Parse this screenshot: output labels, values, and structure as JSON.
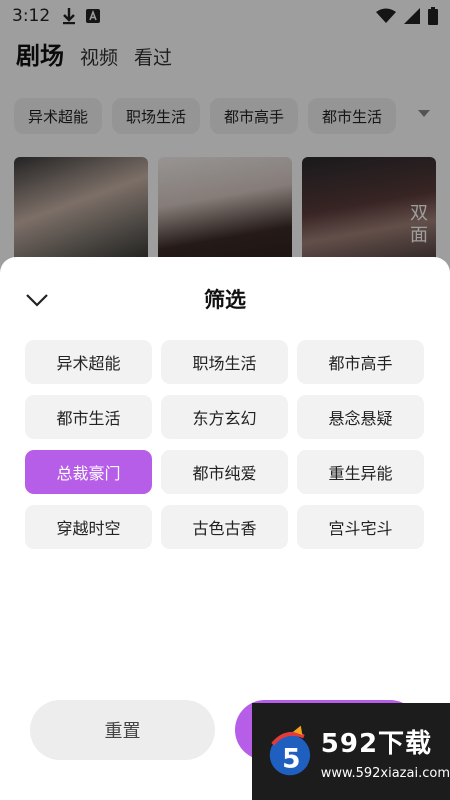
{
  "status_bar": {
    "time": "3:12",
    "icons": [
      "download-icon",
      "a-box-icon",
      "wifi-icon",
      "signal-icon",
      "battery-icon"
    ]
  },
  "top_tabs": [
    {
      "label": "剧场",
      "active": true
    },
    {
      "label": "视频",
      "active": false
    },
    {
      "label": "看过",
      "active": false
    }
  ],
  "top_chips": [
    "异术超能",
    "职场生活",
    "都市高手",
    "都市生活"
  ],
  "posters": [
    {
      "title": ""
    },
    {
      "title": ""
    },
    {
      "title": "双面"
    }
  ],
  "sheet": {
    "title": "筛选",
    "filters": [
      {
        "label": "异术超能",
        "selected": false
      },
      {
        "label": "职场生活",
        "selected": false
      },
      {
        "label": "都市高手",
        "selected": false
      },
      {
        "label": "都市生活",
        "selected": false
      },
      {
        "label": "东方玄幻",
        "selected": false
      },
      {
        "label": "悬念悬疑",
        "selected": false
      },
      {
        "label": "总裁豪门",
        "selected": true
      },
      {
        "label": "都市纯爱",
        "selected": false
      },
      {
        "label": "重生异能",
        "selected": false
      },
      {
        "label": "穿越时空",
        "selected": false
      },
      {
        "label": "古色古香",
        "selected": false
      },
      {
        "label": "宫斗宅斗",
        "selected": false
      }
    ],
    "reset_label": "重置"
  },
  "watermark": {
    "brand": "592下载",
    "url": "www.592xiazai.com"
  },
  "colors": {
    "accent": "#b65ee8",
    "chip_bg": "#f2f2f2",
    "overlay": "rgba(0,0,0,0.38)"
  }
}
